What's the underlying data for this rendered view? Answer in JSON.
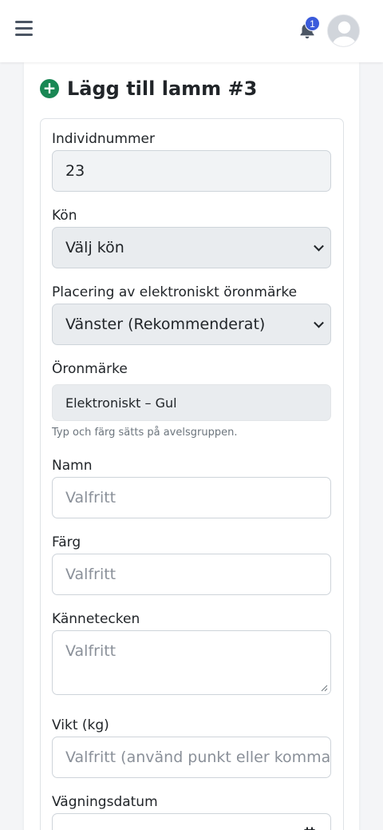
{
  "header": {
    "notification_count": "1",
    "menu_icon": "hamburger-menu-icon",
    "bell_icon": "bell-icon",
    "avatar_icon": "user-avatar-icon"
  },
  "form": {
    "title": "Lägg till lamm #3",
    "title_icon": "plus-circle-icon",
    "accent_color": "#198754",
    "individnummer": {
      "label": "Individnummer",
      "value": "23"
    },
    "kon": {
      "label": "Kön",
      "selected": "Välj kön"
    },
    "placering": {
      "label": "Placering av elektroniskt öronmärke",
      "selected": "Vänster (Rekommenderat)"
    },
    "oronmarke": {
      "label": "Öronmärke",
      "value": "Elektroniskt – Gul",
      "hint": "Typ och färg sätts på avelsgruppen."
    },
    "namn": {
      "label": "Namn",
      "placeholder": "Valfritt"
    },
    "farg": {
      "label": "Färg",
      "placeholder": "Valfritt"
    },
    "kannetecken": {
      "label": "Kännetecken",
      "placeholder": "Valfritt"
    },
    "vikt": {
      "label": "Vikt (kg)",
      "placeholder": "Valfritt (använd punkt eller komma)"
    },
    "vagningsdatum": {
      "label": "Vägningsdatum"
    }
  }
}
